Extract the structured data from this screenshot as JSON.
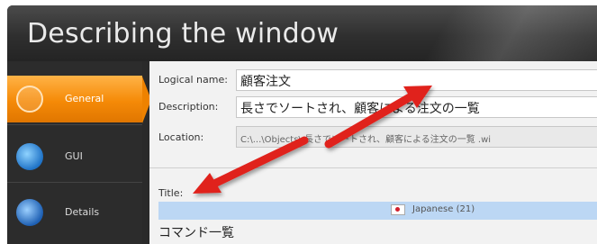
{
  "window": {
    "title": "Describing the window"
  },
  "sidebar": {
    "items": [
      {
        "label": "General",
        "icon": "general-icon",
        "active": true
      },
      {
        "label": "GUI",
        "icon": "gui-icon",
        "active": false
      },
      {
        "label": "Details",
        "icon": "details-icon",
        "active": false
      }
    ]
  },
  "form": {
    "logical_name_label": "Logical name:",
    "logical_name_value": "顧客注文",
    "description_label": "Description:",
    "description_value": "長さでソートされ、顧客による注文の一覧",
    "location_label": "Location:",
    "location_value": "C:\\...\\Objects\\ 長さでソートされ、顧客による注文の一覧 .wi",
    "title_label": "Title:",
    "language_value": "Japanese (21)",
    "title_value": "コマンド一覧"
  },
  "colors": {
    "accent": "#f58a07",
    "annotation_arrow": "#e0201c",
    "selection": "#bcd7f4"
  }
}
